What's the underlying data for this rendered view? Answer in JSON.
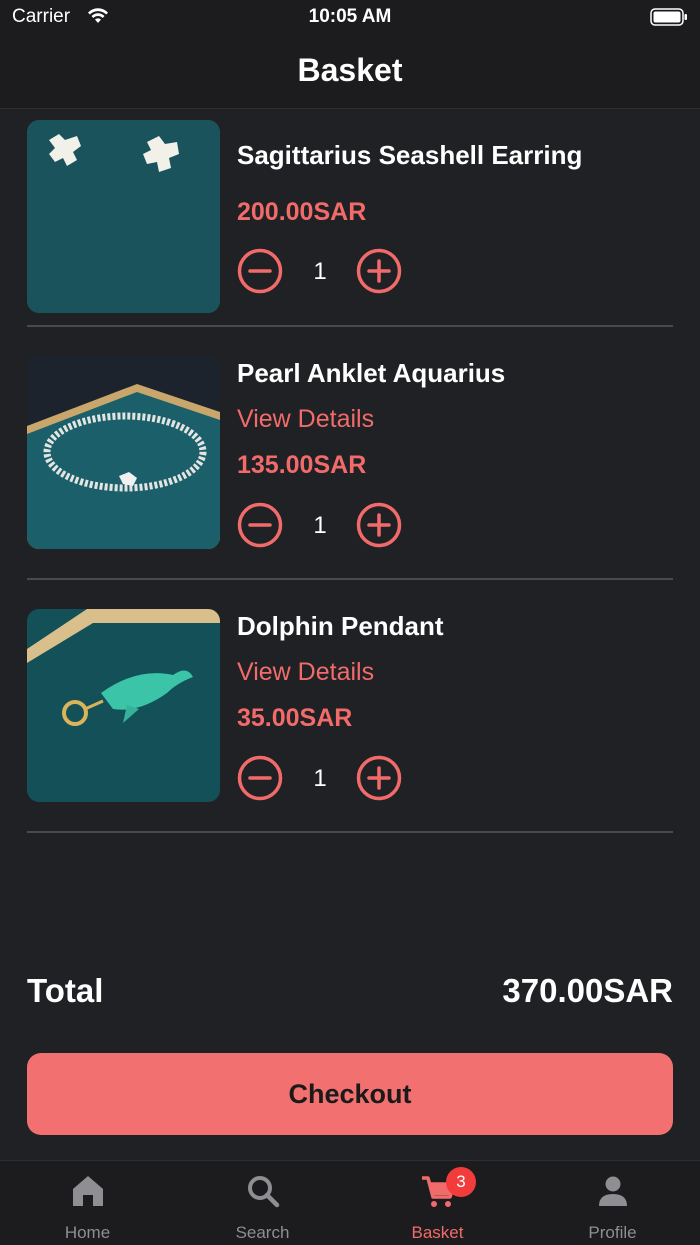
{
  "status_bar": {
    "carrier": "Carrier",
    "time": "10:05 AM"
  },
  "nav": {
    "title": "Basket"
  },
  "items": [
    {
      "name": "Sagittarius Seashell Earring",
      "details_link": "",
      "price": "200.00SAR",
      "quantity": "1",
      "photo": "earring-photo"
    },
    {
      "name": "Pearl Anklet Aquarius",
      "details_link": "View Details",
      "price": "135.00SAR",
      "quantity": "1",
      "photo": "anklet-photo"
    },
    {
      "name": "Dolphin Pendant",
      "details_link": "View Details",
      "price": "35.00SAR",
      "quantity": "1",
      "photo": "pendant-photo"
    }
  ],
  "summary": {
    "total_label": "Total",
    "total_value": "370.00SAR",
    "checkout_label": "Checkout"
  },
  "tab_bar": {
    "tabs": [
      {
        "label": "Home",
        "icon": "home-icon"
      },
      {
        "label": "Search",
        "icon": "search-icon"
      },
      {
        "label": "Basket",
        "icon": "cart-icon",
        "badge": "3"
      },
      {
        "label": "Profile",
        "icon": "person-icon"
      }
    ],
    "active": "Basket"
  },
  "colors": {
    "accent": "#f26b6b",
    "background": "#202124",
    "bar": "#1c1c1e",
    "badge": "#f23c3c"
  }
}
